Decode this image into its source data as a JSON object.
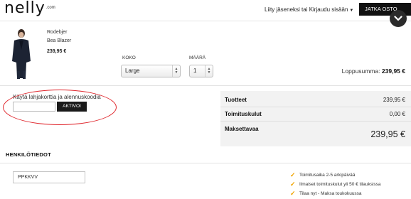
{
  "header": {
    "logo": "nelly",
    "logo_suffix": ".com",
    "login_link": "Liity jäseneksi tai Kirjaudu sisään",
    "checkout_button": "JATKA OSTO"
  },
  "product": {
    "brand": "Rodebjer",
    "name": "Bea Blazer",
    "price": "239,95 €",
    "size_label": "KOKO",
    "size_value": "Large",
    "qty_label": "MÄÄRÄ",
    "qty_value": "1",
    "total_label": "Loppusumma:",
    "total_value": "239,95 €"
  },
  "voucher": {
    "label": "Käytä lahjakorttia ja alennuskoodia",
    "input_value": "",
    "apply_button": "AKTIVOI"
  },
  "summary": {
    "products_label": "Tuotteet",
    "products_value": "239,95 €",
    "shipping_label": "Toimituskulut",
    "shipping_value": "0,00 €",
    "total_label": "Maksettavaa",
    "total_value": "239,95 €"
  },
  "personal": {
    "title": "HENKILÖTIEDOT",
    "name_value": "PPKKVV"
  },
  "perks": [
    "Toimitusaika 2-5 arkipäivää",
    "Ilmaiset toimituskulut yli 50 € tilauksissa",
    "Tilaa nyt - Maksa toukokuussa"
  ],
  "icons": {
    "collapse": "chevron-down-icon",
    "perk": "check-icon"
  },
  "colors": {
    "accent_dark": "#111111",
    "annotation_red": "#e0282e",
    "check_orange": "#f0a400"
  }
}
